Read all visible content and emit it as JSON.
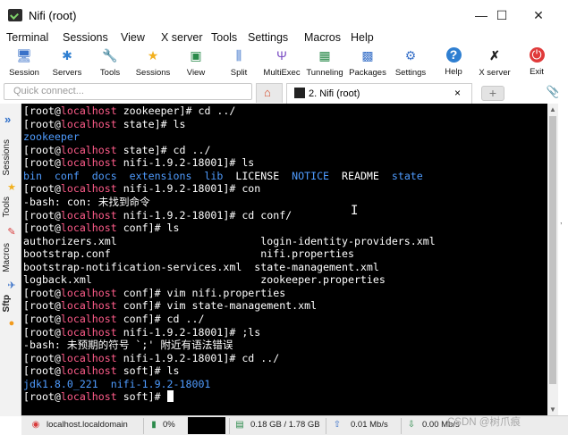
{
  "window": {
    "title": "Nifi (root)",
    "min_glyph": "—",
    "max_glyph": "☐",
    "close_glyph": "✕"
  },
  "menu": [
    "Terminal",
    "Sessions",
    "View",
    "X server",
    "Tools",
    "Settings",
    "Macros",
    "Help"
  ],
  "toolbar": [
    {
      "label": "Session",
      "icon": "session-icon",
      "glyph": "🖥"
    },
    {
      "label": "Servers",
      "icon": "servers-icon",
      "glyph": "✱"
    },
    {
      "label": "Tools",
      "icon": "tools-icon",
      "glyph": "🔧"
    },
    {
      "label": "Sessions",
      "icon": "sessions-star-icon",
      "glyph": "★"
    },
    {
      "label": "View",
      "icon": "view-icon",
      "glyph": "▣"
    },
    {
      "label": "Split",
      "icon": "split-icon",
      "glyph": "⫼"
    },
    {
      "label": "MultiExec",
      "icon": "multiexec-icon",
      "glyph": "Ψ"
    },
    {
      "label": "Tunneling",
      "icon": "tunneling-icon",
      "glyph": "▦"
    },
    {
      "label": "Packages",
      "icon": "packages-icon",
      "glyph": "▩"
    },
    {
      "label": "Settings",
      "icon": "settings-icon",
      "glyph": "⚙"
    },
    {
      "label": "Help",
      "icon": "help-icon",
      "glyph": "?"
    },
    {
      "label": "X server",
      "icon": "xserver-icon",
      "glyph": "✗"
    },
    {
      "label": "Exit",
      "icon": "exit-icon",
      "glyph": "⏻"
    }
  ],
  "quick_connect": {
    "placeholder": "Quick connect..."
  },
  "tabs": {
    "home_glyph": "⌂",
    "active_label": "2. Nifi (root)",
    "close_glyph": "×",
    "new_tab_glyph": "+",
    "attach_glyph": "📎"
  },
  "sidebar": {
    "arrow_glyph": "»",
    "items": [
      "Sessions",
      "Tools",
      "Macros",
      "Sftp"
    ]
  },
  "terminal": {
    "lines": [
      [
        [
          "[root@",
          "t-bold"
        ],
        [
          "localhost",
          "t-host"
        ],
        [
          " zookeeper]# cd ../",
          "t-bold"
        ]
      ],
      [
        [
          "[root@",
          "t-bold"
        ],
        [
          "localhost",
          "t-host"
        ],
        [
          " state]# ls",
          "t-bold"
        ]
      ],
      [
        [
          "zookeeper",
          "t-dir"
        ]
      ],
      [
        [
          "[root@",
          "t-bold"
        ],
        [
          "localhost",
          "t-host"
        ],
        [
          " state]# cd ../",
          "t-bold"
        ]
      ],
      [
        [
          "[root@",
          "t-bold"
        ],
        [
          "localhost",
          "t-host"
        ],
        [
          " nifi-1.9.2-18001]# ls",
          "t-bold"
        ]
      ],
      [
        [
          "bin  conf  docs  extensions  lib",
          "t-dir"
        ],
        [
          "  LICENSE  ",
          "t-bold"
        ],
        [
          "NOTICE",
          "t-dir"
        ],
        [
          "  README  ",
          "t-bold"
        ],
        [
          "state",
          "t-dir"
        ]
      ],
      [
        [
          "[root@",
          "t-bold"
        ],
        [
          "localhost",
          "t-host"
        ],
        [
          " nifi-1.9.2-18001]# con",
          "t-bold"
        ]
      ],
      [
        [
          "-bash: con: 未找到命令",
          "t-bold"
        ]
      ],
      [
        [
          "[root@",
          "t-bold"
        ],
        [
          "localhost",
          "t-host"
        ],
        [
          " nifi-1.9.2-18001]# cd conf/",
          "t-bold"
        ]
      ],
      [
        [
          "[root@",
          "t-bold"
        ],
        [
          "localhost",
          "t-host"
        ],
        [
          " conf]# ls",
          "t-bold"
        ]
      ],
      [
        [
          "authorizers.xml                       login-identity-providers.xml",
          "t-bold"
        ]
      ],
      [
        [
          "bootstrap.conf                        nifi.properties",
          "t-bold"
        ]
      ],
      [
        [
          "bootstrap-notification-services.xml  state-management.xml",
          "t-bold"
        ]
      ],
      [
        [
          "logback.xml                           zookeeper.properties",
          "t-bold"
        ]
      ],
      [
        [
          "[root@",
          "t-bold"
        ],
        [
          "localhost",
          "t-host"
        ],
        [
          " conf]# vim nifi.properties",
          "t-bold"
        ]
      ],
      [
        [
          "[root@",
          "t-bold"
        ],
        [
          "localhost",
          "t-host"
        ],
        [
          " conf]# vim state-management.xml",
          "t-bold"
        ]
      ],
      [
        [
          "[root@",
          "t-bold"
        ],
        [
          "localhost",
          "t-host"
        ],
        [
          " conf]# cd ../",
          "t-bold"
        ]
      ],
      [
        [
          "[root@",
          "t-bold"
        ],
        [
          "localhost",
          "t-host"
        ],
        [
          " nifi-1.9.2-18001]# ;ls",
          "t-bold"
        ]
      ],
      [
        [
          "-bash: 未预期的符号 `;' 附近有语法错误",
          "t-bold"
        ]
      ],
      [
        [
          "[root@",
          "t-bold"
        ],
        [
          "localhost",
          "t-host"
        ],
        [
          " nifi-1.9.2-18001]# cd ../",
          "t-bold"
        ]
      ],
      [
        [
          "[root@",
          "t-bold"
        ],
        [
          "localhost",
          "t-host"
        ],
        [
          " soft]# ls",
          "t-bold"
        ]
      ],
      [
        [
          "jdk1.8.0_221  nifi-1.9.2-18001",
          "t-dir"
        ]
      ],
      [
        [
          "[root@",
          "t-bold"
        ],
        [
          "localhost",
          "t-host"
        ],
        [
          " soft]# ",
          "t-bold"
        ]
      ]
    ]
  },
  "status": {
    "host": "localhost.localdomain",
    "cpu": "0%",
    "memory": "0.18 GB / 1.78 GB",
    "upload": "0.01 Mb/s",
    "download": "0.00 Mb/s",
    "watermark": "CSDN @树爪痕"
  },
  "colors": {
    "terminal_bg": "#000000",
    "prompt_host": "#ff5c8a",
    "directory": "#4f9cff",
    "accent": "#3a72c9"
  }
}
